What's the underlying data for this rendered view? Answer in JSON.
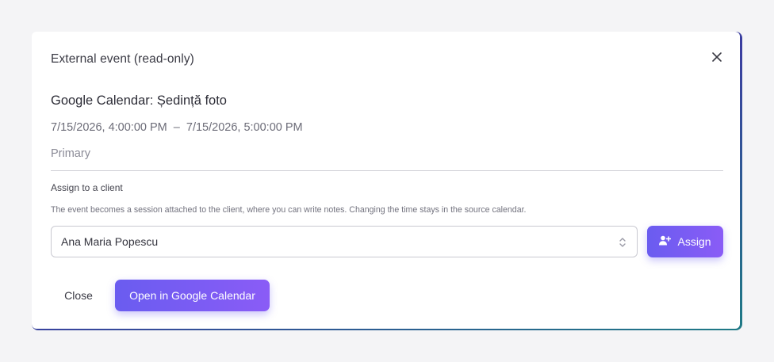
{
  "dialog": {
    "title": "External event (read-only)",
    "close_icon": "close-icon"
  },
  "event": {
    "title": "Google Calendar: Ședință foto",
    "time_range": "7/15/2026, 4:00:00 PM  –  7/15/2026, 5:00:00 PM",
    "calendar": "Primary"
  },
  "assign": {
    "label": "Assign to a client",
    "help": "The event becomes a session attached to the client, where you can write notes. Changing the time stays in the source calendar.",
    "selected_client": "Ana Maria Popescu",
    "select_icon": "chevron-up-down-icon",
    "button_label": "Assign",
    "button_icon": "user-plus-icon"
  },
  "footer": {
    "close_label": "Close",
    "open_label": "Open in Google Calendar"
  },
  "colors": {
    "accent_start": "#6a5cf0",
    "accent_end": "#8a5cf6",
    "background": "#f4f4f6"
  }
}
